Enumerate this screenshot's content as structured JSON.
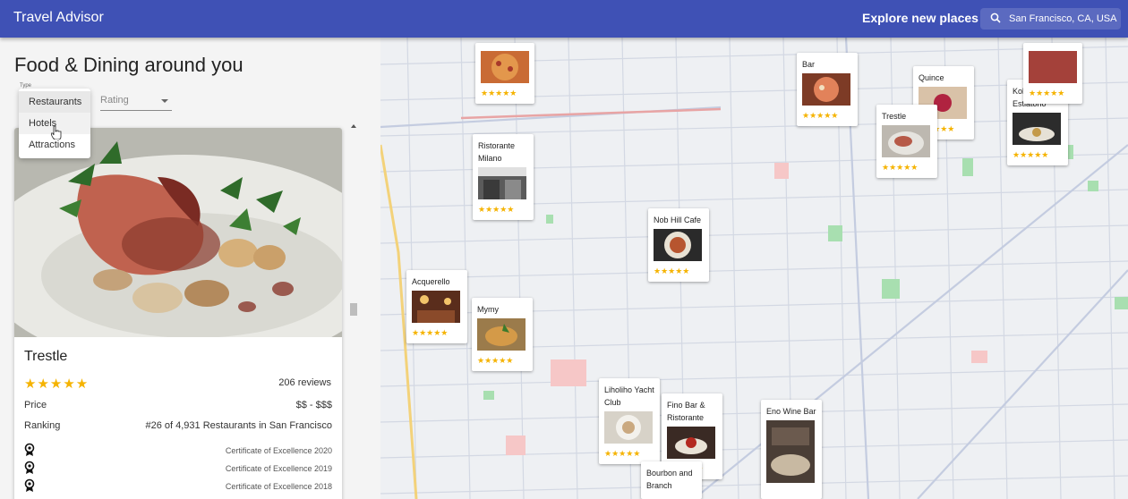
{
  "header": {
    "title": "Travel Advisor",
    "explore_label": "Explore new places",
    "search_value": "San Francisco, CA, USA"
  },
  "left": {
    "page_title": "Food & Dining around you",
    "type_label": "Type",
    "type_options": [
      "Restaurants",
      "Hotels",
      "Attractions"
    ],
    "rating_placeholder": "Rating"
  },
  "place": {
    "name": "Trestle",
    "stars": "★★★★★",
    "reviews": "206 reviews",
    "price_label": "Price",
    "price_value": "$$ - $$$",
    "ranking_label": "Ranking",
    "ranking_value": "#26 of 4,931 Restaurants in San Francisco",
    "awards": [
      "Certificate of Excellence 2020",
      "Certificate of Excellence 2019",
      "Certificate of Excellence 2018"
    ]
  },
  "map": {
    "stars": "★★★★★",
    "markers": [
      {
        "name": ""
      },
      {
        "name": "Bar"
      },
      {
        "name": "Quince"
      },
      {
        "name": "Kokkari Estiatorio"
      },
      {
        "name": "Trestle"
      },
      {
        "name": "Ristorante Milano"
      },
      {
        "name": "Nob Hill Cafe"
      },
      {
        "name": "Acquerello"
      },
      {
        "name": "Mymy"
      },
      {
        "name": "Liholiho Yacht Club"
      },
      {
        "name": "Fino Bar & Ristorante"
      },
      {
        "name": "Eno Wine Bar"
      },
      {
        "name": "Bourbon and Branch"
      }
    ]
  },
  "colors": {
    "appbar": "#3f51b5",
    "star": "#f5b301"
  }
}
